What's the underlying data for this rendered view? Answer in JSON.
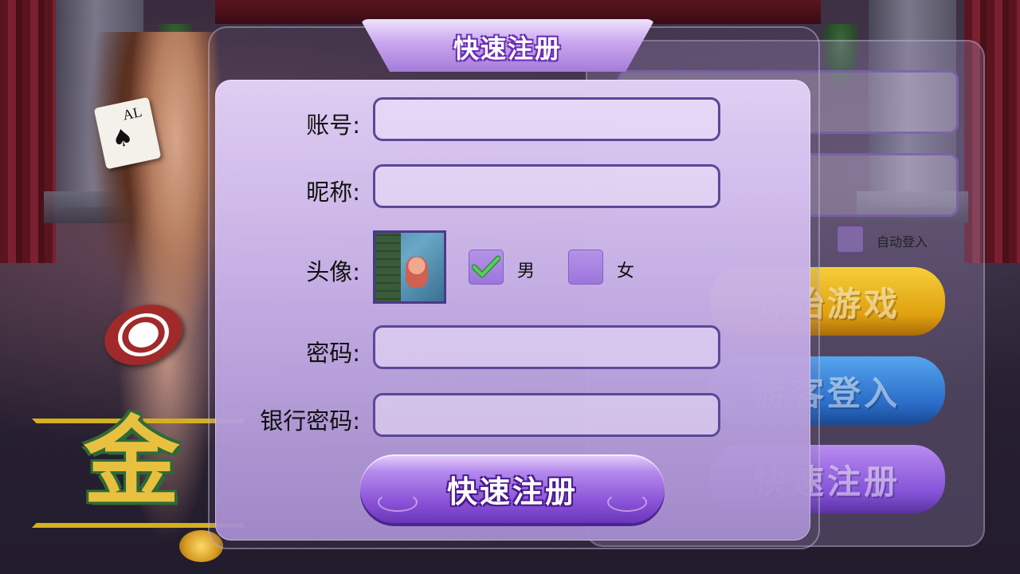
{
  "dialog": {
    "title": "快速注册"
  },
  "form": {
    "account_label": "账号:",
    "account_value": "",
    "nickname_label": "昵称:",
    "nickname_value": "",
    "avatar_label": "头像:",
    "gender": {
      "male_label": "男",
      "female_label": "女",
      "selected": "male"
    },
    "password_label": "密码:",
    "password_value": "",
    "bank_password_label": "银行密码:",
    "bank_password_value": "",
    "submit_label": "快速注册"
  },
  "background_login": {
    "auto_login_label": "自动登入",
    "buttons": [
      "开始游戏",
      "游客登入",
      "快速注册"
    ]
  },
  "decor": {
    "ace_card_letter": "AL",
    "logo_glyph": "金"
  },
  "colors": {
    "accent_purple": "#8a52d8",
    "field_border": "#5a4898",
    "check_green": "#3ec04a",
    "start_yellow": "#e0a010",
    "guest_blue": "#2a6cc8"
  }
}
